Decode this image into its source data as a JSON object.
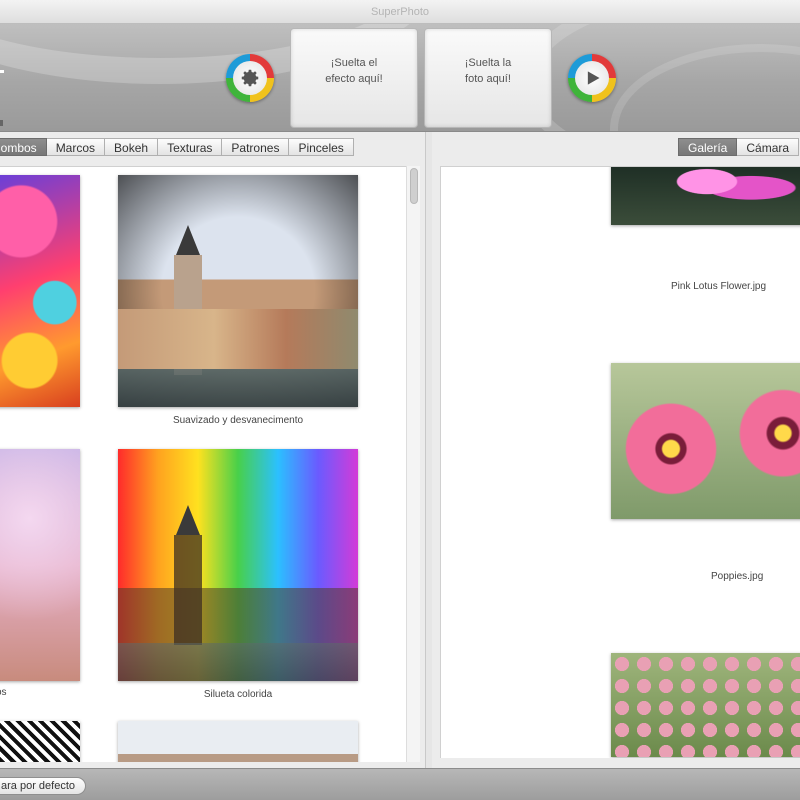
{
  "window": {
    "title": "SuperPhoto"
  },
  "toolbar": {
    "drop_effect": "¡Suelta el\nefecto aquí!",
    "drop_photo": "¡Suelta la\nfoto aquí!"
  },
  "effects_tabs": [
    {
      "label": "Combos",
      "active": true
    },
    {
      "label": "Marcos",
      "active": false
    },
    {
      "label": "Bokeh",
      "active": false
    },
    {
      "label": "Texturas",
      "active": false
    },
    {
      "label": "Patrones",
      "active": false
    },
    {
      "label": "Pinceles",
      "active": false
    }
  ],
  "effects": {
    "items": [
      {
        "label": ""
      },
      {
        "label": "Suavizado y desvanecimento"
      },
      {
        "label": "os"
      },
      {
        "label": "Silueta colorida"
      },
      {
        "label": ""
      },
      {
        "label": ""
      }
    ]
  },
  "gallery_tabs": [
    {
      "label": "Galería",
      "active": true
    },
    {
      "label": "Cámara",
      "active": false
    }
  ],
  "gallery": {
    "items": [
      {
        "label": ""
      },
      {
        "label": "Pink Lotus Flower.jpg"
      },
      {
        "label": "Poppies.jpg"
      },
      {
        "label": ""
      }
    ]
  },
  "footer": {
    "default_button": "ara por defecto"
  },
  "icons": {
    "settings": "gear-icon",
    "play": "play-icon"
  },
  "colors": {
    "tab_active": "#7f7f7f",
    "header_gray": "#a6a6a6",
    "ring_red": "#e23a3a",
    "ring_yellow": "#f0c21c",
    "ring_green": "#3fb43a",
    "ring_blue": "#1d9bd8"
  }
}
